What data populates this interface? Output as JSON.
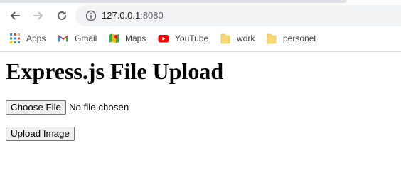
{
  "browser": {
    "url_host": "127.0.0.1",
    "url_port": ":8080",
    "bookmarks": [
      {
        "label": "Apps",
        "icon": "apps-grid-icon"
      },
      {
        "label": "Gmail",
        "icon": "gmail-icon"
      },
      {
        "label": "Maps",
        "icon": "maps-icon"
      },
      {
        "label": "YouTube",
        "icon": "youtube-icon"
      },
      {
        "label": "work",
        "icon": "folder-icon"
      },
      {
        "label": "personel",
        "icon": "folder-icon"
      }
    ]
  },
  "page": {
    "title": "Express.js File Upload",
    "choose_file_label": "Choose File",
    "no_file_text": "No file chosen",
    "upload_label": "Upload Image"
  },
  "colors": {
    "folder": "#f9d776",
    "youtube": "#ff0000",
    "omnibox_bg": "#f1f3f4"
  }
}
